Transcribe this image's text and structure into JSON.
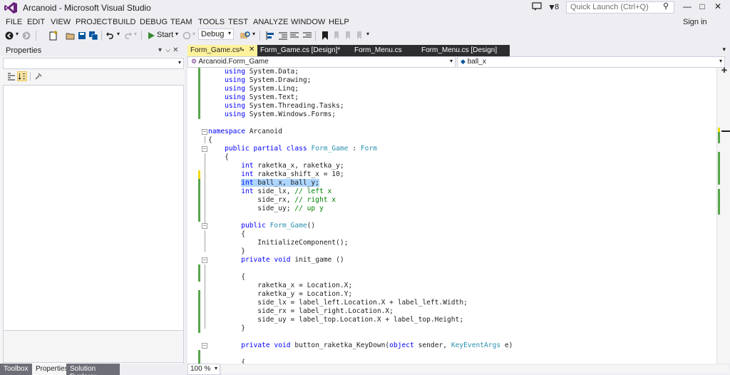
{
  "window": {
    "title": "Arcanoid - Microsoft Visual Studio",
    "feedback_count": "8",
    "quick_launch_placeholder": "Quick Launch (Ctrl+Q)",
    "minimize": "—",
    "restore": "□",
    "close": "✕"
  },
  "menu": [
    "FILE",
    "EDIT",
    "VIEW",
    "PROJECT",
    "BUILD",
    "DEBUG",
    "TEAM",
    "TOOLS",
    "TEST",
    "ANALYZE",
    "WINDOW",
    "HELP"
  ],
  "sign_in": "Sign in",
  "toolbar": {
    "start_label": "Start",
    "config": "Debug"
  },
  "properties": {
    "title": "Properties",
    "pin": "▾  ⌵ ✕"
  },
  "bottom_tabs": [
    "Toolbox",
    "Properties",
    "Solution Explorer"
  ],
  "doc_tabs": [
    {
      "label": "Form_Game.cs*",
      "active": true
    },
    {
      "label": "Form_Game.cs [Design]*",
      "active": false
    },
    {
      "label": "Form_Menu.cs",
      "active": false
    },
    {
      "label": "Form_Menu.cs [Design]",
      "active": false
    }
  ],
  "nav": {
    "type": "Arcanoid.Form_Game",
    "member": "ball_x"
  },
  "code_lines": [
    "    using System.Data;",
    "    using System.Drawing;",
    "    using System.Linq;",
    "    using System.Text;",
    "    using System.Threading.Tasks;",
    "    using System.Windows.Forms;",
    "",
    "namespace Arcanoid",
    "{",
    "    public partial class Form_Game : Form",
    "    {",
    "        int raketka_x, raketka_y;",
    "        int raketka_shift_x = 10;",
    "        int ball_x, ball_y;",
    "        int side_lx, // left x",
    "            side_rx, // right x",
    "            side_uy; // up y",
    "",
    "        public Form_Game()",
    "        {",
    "            InitializeComponent();",
    "        }",
    "        private void init_game ()",
    "",
    "        {",
    "            raketka_x = Location.X;",
    "            raketka_y = Location.Y;",
    "            side_lx = label_left.Location.X + label_left.Width;",
    "            side_rx = label_right.Location.X;",
    "            side_uy = label_top.Location.X + label_top.Height;",
    "        }",
    "",
    "        private void button_raketka_KeyDown(object sender, KeyEventArgs e)",
    "",
    "        {"
  ],
  "zoom": "100 %",
  "colors": {
    "keyword": "#0000ff",
    "type": "#2b91af",
    "comment": "#008000",
    "active_tab": "#fff29d",
    "selection": "#add6ff",
    "change_saved": "#57a64a",
    "change_unsaved": "#efdb00",
    "vs_purple": "#68217a"
  }
}
